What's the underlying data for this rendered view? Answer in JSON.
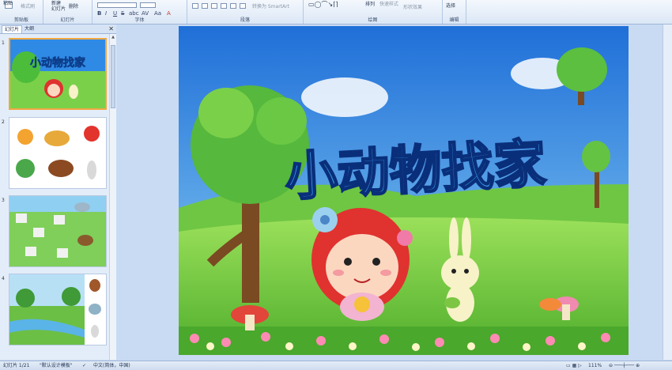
{
  "ribbon": {
    "clipboard": {
      "paste": "粘贴",
      "format_painter": "格式刷",
      "label": "剪贴板"
    },
    "slides": {
      "new_slide": "新建\n幻灯片",
      "delete": "删除",
      "label": "幻灯片"
    },
    "font": {
      "label": "字体",
      "bold": "B",
      "italic": "I",
      "underline": "U",
      "strike": "S",
      "shadow": "abc",
      "spacing": "AV",
      "case": "Aa",
      "color": "A"
    },
    "paragraph": {
      "label": "段落",
      "smartart": "转换为 SmartArt"
    },
    "drawing": {
      "label": "绘图",
      "arrange": "排列",
      "quick_styles": "快速样式",
      "shape_effects": "形状效果"
    },
    "editing": {
      "label": "编辑",
      "select": "选择"
    }
  },
  "panel": {
    "tabs": [
      "幻灯片",
      "大纲"
    ],
    "close": "✕",
    "thumbs": [
      {
        "num": "1",
        "title": "小动物找家"
      },
      {
        "num": "2",
        "title": ""
      },
      {
        "num": "3",
        "title": ""
      },
      {
        "num": "4",
        "title": ""
      }
    ]
  },
  "slide": {
    "title": "小动物找家"
  },
  "status": {
    "slide_info": "幻灯片 1/21",
    "theme": "\"默认设计模板\"",
    "language": "中文(简体，中国)",
    "zoom": "111%"
  },
  "colors": {
    "title_fill": "#3aa0f0",
    "sky": "#2f7fe0",
    "grass": "#6cc63a"
  }
}
